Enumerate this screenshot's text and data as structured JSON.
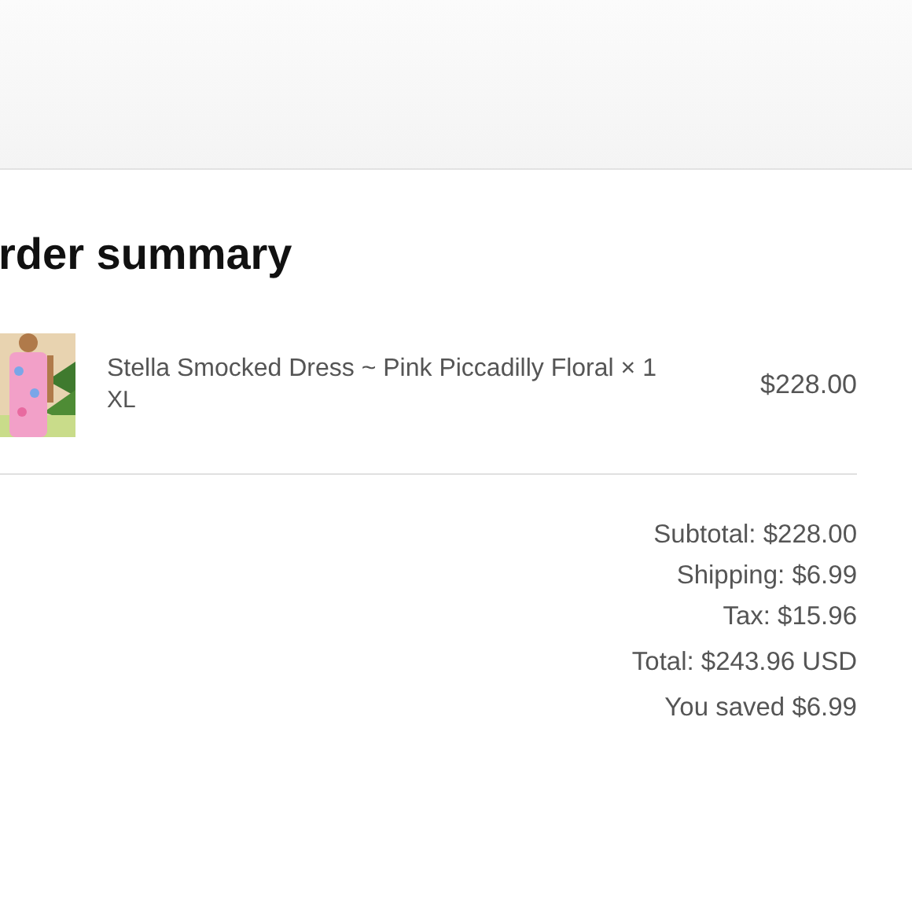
{
  "heading": "rder summary",
  "items": [
    {
      "kind": "picture",
      "name": "Stella Smocked Dress ~ Pink Piccadilly Floral × 1",
      "variant": "XL",
      "price": "$228.00"
    }
  ],
  "totals": [
    {
      "text": "Subtotal: $228.00"
    },
    {
      "text": "Shipping: $6.99"
    },
    {
      "text": "Tax: $15.96"
    },
    {
      "text": "Total: $243.96 USD"
    },
    {
      "text": "You saved $6.99"
    }
  ]
}
